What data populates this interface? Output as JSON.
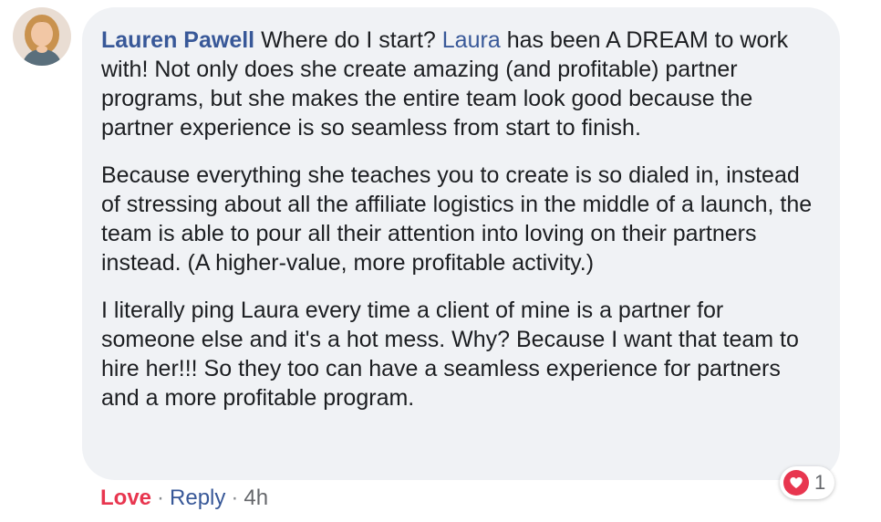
{
  "comment": {
    "author": "Lauren Pawell",
    "paragraphs": [
      {
        "lead": "Where do I start?",
        "mention": "Laura",
        "rest": "has been A DREAM to work with! Not only does she create amazing (and profitable) partner programs, but she makes the entire team look good because the partner experience is so seamless from start to finish."
      },
      {
        "text": "Because everything she teaches you to create is so dialed in, instead of stressing about all the affiliate logistics in the middle of a launch, the team is able to pour all their attention into loving on their partners instead. (A higher-value, more profitable activity.)"
      },
      {
        "text": "I literally ping Laura every time a client of mine is a partner for someone else and it's a hot mess. Why? Because I want that team to hire her!!! So they too can have a seamless experience for partners and a more profitable program."
      }
    ]
  },
  "reactions": {
    "icon": "heart-icon",
    "count": "1",
    "color": "#e8364f"
  },
  "actions": {
    "love_label": "Love",
    "reply_label": "Reply",
    "separator": "·",
    "timestamp": "4h"
  },
  "colors": {
    "link": "#385898",
    "bubble": "#f0f2f5",
    "text": "#1c1e21",
    "muted": "#65676b"
  }
}
